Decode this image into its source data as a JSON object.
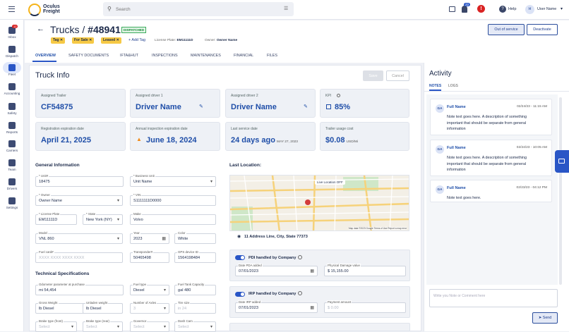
{
  "app": {
    "brand_line1": "Oculus",
    "brand_line2": "Freight"
  },
  "search": {
    "placeholder": "Search"
  },
  "header": {
    "badge_count": "22",
    "help": "Help",
    "user_initial": "H",
    "user_name": "User Name"
  },
  "nav": [
    {
      "label": "Inbox",
      "badge": "12",
      "icon": "inbox-icon"
    },
    {
      "label": "Dispatch",
      "icon": "calendar-icon"
    },
    {
      "label": "Fleet",
      "icon": "truck-icon"
    },
    {
      "label": "Accounting",
      "icon": "dollar-icon"
    },
    {
      "label": "Safety",
      "icon": "shield-icon"
    },
    {
      "label": "Reports",
      "icon": "reports-icon"
    },
    {
      "label": "Carriers",
      "icon": "location-pin-icon"
    },
    {
      "label": "Team",
      "icon": "team-icon"
    },
    {
      "label": "Drivers",
      "icon": "driver-card-icon"
    },
    {
      "label": "Settings",
      "icon": "gear-icon"
    }
  ],
  "page": {
    "title_prefix": "Trucks /",
    "title_id": "#48941",
    "status": "DISPATCHED",
    "tags": [
      "Tag",
      "For Sale",
      "Leased"
    ],
    "add_tag": "Add Tag",
    "plate_label": "License Plate:",
    "plate": "EM11111D",
    "owner_label": "Owner:",
    "owner": "Owner Name",
    "btn_out": "Out of service",
    "btn_deactivate": "Deactivate"
  },
  "tabs": [
    "OVERVIEW",
    "SAFETY DOCUMENTS",
    "IFTA&HUT",
    "INSPECTIONS",
    "MAINTENANCES",
    "FINANCIAL",
    "FILES"
  ],
  "info": {
    "title": "Truck Info",
    "save": "Save",
    "cancel": "Cancel"
  },
  "cards": [
    {
      "label": "Assigned Trailer",
      "value": "CF54875"
    },
    {
      "label": "Assigned driver 1",
      "value": "Driver Name"
    },
    {
      "label": "Assigned driver 2",
      "value": "Driver Name"
    },
    {
      "label": "KPI",
      "value": "85%"
    },
    {
      "label": "Registration expiration date",
      "value": "April 21, 2025"
    },
    {
      "label": "Annual inspection expiration date",
      "value": "June 18, 2024"
    },
    {
      "label": "Last service date",
      "value": "24 days ago",
      "extra": "MAY 27, 2023"
    },
    {
      "label": "Trailer usage cost",
      "value": "$0.08",
      "extra": "USD/Mi"
    }
  ],
  "general": {
    "title": "General Information",
    "fields": [
      {
        "label": "* Unit#",
        "value": "18475"
      },
      {
        "label": "* Business Unit",
        "value": "Unit Name"
      },
      {
        "label": "* Owner",
        "value": "Owner Name"
      },
      {
        "label": "* VIN",
        "value": "S1111111D0000"
      },
      {
        "label": "* License Plate",
        "value": "EM11111D"
      },
      {
        "label": "* State",
        "value": "New York (NY)"
      },
      {
        "label": "Make",
        "value": "Volvo"
      },
      {
        "label": "Model",
        "value": "VNL 860"
      },
      {
        "label": "Year",
        "value": "2023"
      },
      {
        "label": "Color",
        "value": "White"
      },
      {
        "label": "Fuel card#",
        "value": "XXXX XXXX XXXX XXXX"
      },
      {
        "label": "Transponder#",
        "value": "50465498"
      },
      {
        "label": "GPS device ID",
        "value": "1564198484"
      }
    ]
  },
  "tech": {
    "title": "Technical Specifications",
    "fields": [
      {
        "label": "Odometer parameter at purchase",
        "value": "mi 54,454"
      },
      {
        "label": "Fuel type",
        "value": "Diesel"
      },
      {
        "label": "Fuel Tank Capacity",
        "value": "gal 480"
      },
      {
        "label": "Gross Weight",
        "value": "lb Diesel"
      },
      {
        "label": "Unladen weight",
        "value": "lb Diesel"
      },
      {
        "label": "Number of Axles",
        "value": "3"
      },
      {
        "label": "Tire size",
        "value": "in 24"
      },
      {
        "label": "Brake type (front)",
        "value": "Select"
      },
      {
        "label": "Brake type (rear)",
        "value": "Select"
      },
      {
        "label": "Governor",
        "value": "Select"
      },
      {
        "label": "Dash Cam",
        "value": "Select"
      }
    ]
  },
  "location": {
    "title": "Last Location:",
    "address": "11 Address Line, City, State 77373",
    "live": "Live Location OFF",
    "map_data": "Map data ©2023 Google",
    "terms": "Terms of Use",
    "report": "Report a map error"
  },
  "pdi": {
    "label": "PDI handled by Company",
    "date_label": "Date PDA added",
    "date": "07/01/2023",
    "dmg_label": "Physical Damage value",
    "dmg": "$ 15,155.00"
  },
  "irp": {
    "label": "IRP handled by Company",
    "date_label": "Date IRP added",
    "date": "07/01/2023",
    "pay_label": "Payment amount",
    "pay": "$ 0.00"
  },
  "activity": {
    "title": "Activity",
    "tab_notes": "NOTES",
    "tab_logs": "LOGS",
    "notes": [
      {
        "initials": "GA",
        "name": "Full Name",
        "date": "02/24/23 - 11:15 AM",
        "text": "Note text goes here. A description of something important that should be separate from general information"
      },
      {
        "initials": "GA",
        "name": "Full Name",
        "date": "02/24/23 - 10:05 AM",
        "text": "Note text goes here. A description of something important that should be separate from general information"
      },
      {
        "initials": "GA",
        "name": "Full Name",
        "date": "02/23/23 - 04:12 PM",
        "text": "Note text goes here."
      }
    ],
    "input_placeholder": "Write you Note or Comment here",
    "send": "Send"
  }
}
